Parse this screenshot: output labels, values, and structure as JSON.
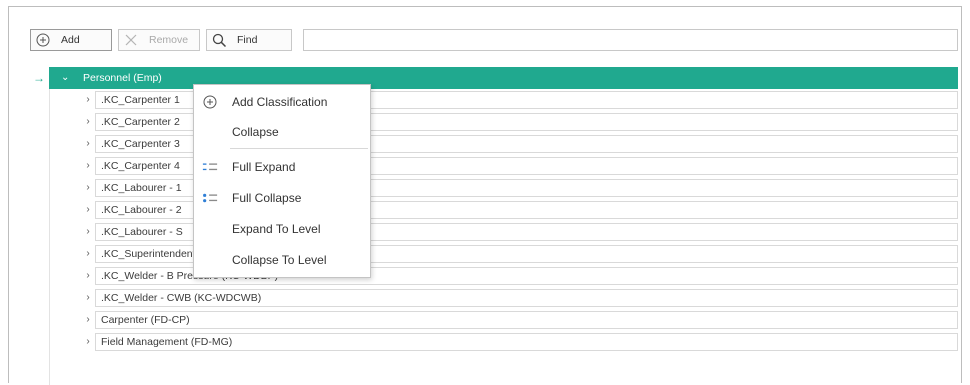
{
  "toolbar": {
    "add_label": "Add",
    "remove_label": "Remove",
    "find_label": "Find",
    "search_value": ""
  },
  "tree": {
    "root_label": "Personnel (Emp)",
    "rows": [
      ".KC_Carpenter 1",
      ".KC_Carpenter 2",
      ".KC_Carpenter 3",
      ".KC_Carpenter 4",
      ".KC_Labourer - 1",
      ".KC_Labourer - 2",
      ".KC_Labourer - S",
      ".KC_Superintendent",
      ".KC_Welder - B Pressure (KC-WDBP)",
      ".KC_Welder - CWB (KC-WDCWB)",
      "Carpenter (FD-CP)",
      "Field Management (FD-MG)"
    ]
  },
  "context_menu": {
    "add_classification": "Add Classification",
    "collapse": "Collapse",
    "full_expand": "Full Expand",
    "full_collapse": "Full Collapse",
    "expand_to_level": "Expand To Level",
    "collapse_to_level": "Collapse To Level"
  },
  "colors": {
    "accent": "#20a98f",
    "icon_blue": "#2f7fd6"
  }
}
